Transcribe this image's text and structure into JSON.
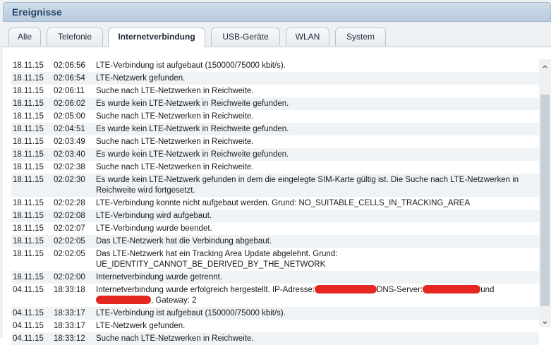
{
  "window": {
    "title": "Ereignisse"
  },
  "tabs": [
    {
      "label": "Alle"
    },
    {
      "label": "Telefonie"
    },
    {
      "label": "Internetverbindung"
    },
    {
      "label": "USB-Geräte"
    },
    {
      "label": "WLAN"
    },
    {
      "label": "System"
    }
  ],
  "active_tab": "Internetverbindung",
  "events": [
    {
      "date": "18.11.15",
      "time": "02:06:56",
      "message": "LTE-Verbindung ist aufgebaut (150000/75000 kbit/s)."
    },
    {
      "date": "18.11.15",
      "time": "02:06:54",
      "message": "LTE-Netzwerk gefunden."
    },
    {
      "date": "18.11.15",
      "time": "02:06:11",
      "message": "Suche nach LTE-Netzwerken in Reichweite."
    },
    {
      "date": "18.11.15",
      "time": "02:06:02",
      "message": "Es wurde kein LTE-Netzwerk in Reichweite gefunden."
    },
    {
      "date": "18.11.15",
      "time": "02:05:00",
      "message": "Suche nach LTE-Netzwerken in Reichweite."
    },
    {
      "date": "18.11.15",
      "time": "02:04:51",
      "message": "Es wurde kein LTE-Netzwerk in Reichweite gefunden."
    },
    {
      "date": "18.11.15",
      "time": "02:03:49",
      "message": "Suche nach LTE-Netzwerken in Reichweite."
    },
    {
      "date": "18.11.15",
      "time": "02:03:40",
      "message": "Es wurde kein LTE-Netzwerk in Reichweite gefunden."
    },
    {
      "date": "18.11.15",
      "time": "02:02:38",
      "message": "Suche nach LTE-Netzwerken in Reichweite."
    },
    {
      "date": "18.11.15",
      "time": "02:02:30",
      "message": "Es wurde kein LTE-Netzwerk gefunden in dem die eingelegte SIM-Karte gültig ist. Die Suche nach LTE-Netzwerken in Reichweite wird fortgesetzt."
    },
    {
      "date": "18.11.15",
      "time": "02:02:28",
      "message": "LTE-Verbindung konnte nicht aufgebaut werden. Grund: NO_SUITABLE_CELLS_IN_TRACKING_AREA"
    },
    {
      "date": "18.11.15",
      "time": "02:02:08",
      "message": "LTE-Verbindung wird aufgebaut."
    },
    {
      "date": "18.11.15",
      "time": "02:02:07",
      "message": "LTE-Verbindung wurde beendet."
    },
    {
      "date": "18.11.15",
      "time": "02:02:05",
      "message": "Das LTE-Netzwerk hat die Verbindung abgebaut."
    },
    {
      "date": "18.11.15",
      "time": "02:02:05",
      "message": "Das LTE-Netzwerk hat ein Tracking Area Update abgelehnt. Grund: UE_IDENTITY_CANNOT_BE_DERIVED_BY_THE_NETWORK"
    },
    {
      "date": "18.11.15",
      "time": "02:02:00",
      "message": "Internetverbindung wurde getrennt."
    },
    {
      "date": "04.11.15",
      "time": "18:33:18",
      "message": "",
      "redacted": true,
      "parts": [
        "Internetverbindung wurde erfolgreich hergestellt. IP-Adresse:",
        "DNS-Server:",
        "und",
        ", Gateway: 2"
      ]
    },
    {
      "date": "04.11.15",
      "time": "18:33:17",
      "message": "LTE-Verbindung ist aufgebaut (150000/75000 kbit/s)."
    },
    {
      "date": "04.11.15",
      "time": "18:33:17",
      "message": "LTE-Netzwerk gefunden."
    },
    {
      "date": "04.11.15",
      "time": "18:33:12",
      "message": "Suche nach LTE-Netzwerken in Reichweite."
    }
  ],
  "colors": {
    "title_text": "#27486b",
    "redaction": "#e5281f"
  }
}
